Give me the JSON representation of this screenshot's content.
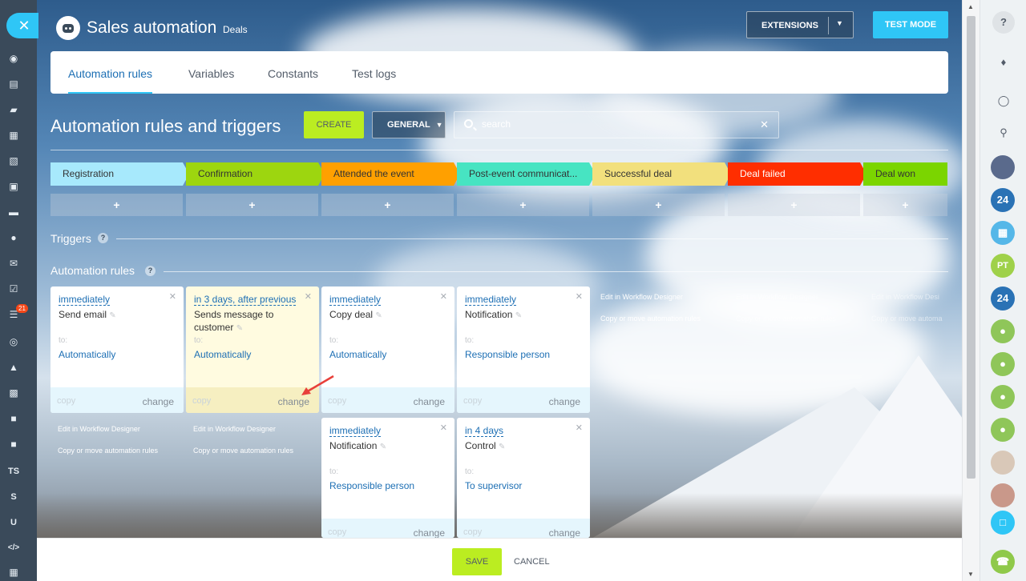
{
  "header": {
    "app_title": "Sales automation",
    "subtitle": "Deals",
    "extensions_label": "EXTENSIONS",
    "test_mode_label": "TEST MODE"
  },
  "tabs": [
    {
      "label": "Automation rules"
    },
    {
      "label": "Variables"
    },
    {
      "label": "Constants"
    },
    {
      "label": "Test logs"
    }
  ],
  "toolbar": {
    "title": "Automation rules and triggers",
    "create_label": "CREATE",
    "general_label": "GENERAL",
    "search_placeholder": "search"
  },
  "stages": [
    {
      "label": "Registration",
      "color": "#a7e9fc"
    },
    {
      "label": "Confirmation",
      "color": "#9dd60f"
    },
    {
      "label": "Attended the event",
      "color": "#ffa000"
    },
    {
      "label": "Post-event communicat...",
      "color": "#47e4c2"
    },
    {
      "label": "Successful deal",
      "color": "#f2e07d"
    },
    {
      "label": "Deal failed",
      "color": "#ff2e00"
    },
    {
      "label": "Deal won",
      "color": "#7bd500"
    }
  ],
  "add_symbol": "+",
  "sections": {
    "triggers": "Triggers",
    "automation_rules": "Automation rules",
    "help": "?"
  },
  "cards": [
    {
      "when": "immediately",
      "name": "Send email",
      "to": "to:",
      "target": "Automatically",
      "copy": "copy",
      "change": "change"
    },
    {
      "when": "in 3 days, after previous",
      "name": "Sends message to customer",
      "to": "to:",
      "target": "Automatically",
      "copy": "copy",
      "change": "change"
    },
    {
      "when": "immediately",
      "name": "Copy deal",
      "to": "to:",
      "target": "Automatically",
      "copy": "copy",
      "change": "change"
    },
    {
      "when": "immediately",
      "name": "Notification",
      "to": "to:",
      "target": "Responsible person",
      "copy": "copy",
      "change": "change"
    },
    {
      "when": "immediately",
      "name": "Notification",
      "to": "to:",
      "target": "Responsible person",
      "copy": "copy",
      "change": "change"
    },
    {
      "when": "in 4 days",
      "name": "Control",
      "to": "to:",
      "target": "To supervisor",
      "copy": "copy",
      "change": "change"
    }
  ],
  "links": {
    "edit_designer": "Edit in Workflow Designer",
    "copy_move": "Copy or move automation rules",
    "edit_designer_cut": "Edit in Workflow Desi",
    "copy_move_cut": "Copy or move automa"
  },
  "footer": {
    "save_label": "SAVE",
    "cancel_label": "CANCEL"
  },
  "left_bar": {
    "badge": "21",
    "ts": "TS",
    "s": "S",
    "u": "U",
    "code": "</>"
  },
  "right_bar": {
    "help": "?",
    "b24": "24",
    "pt": "PT"
  }
}
